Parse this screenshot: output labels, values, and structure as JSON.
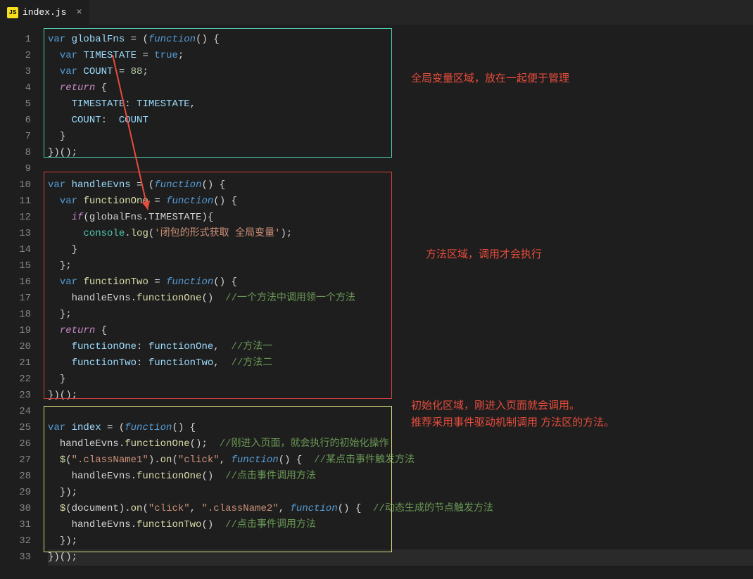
{
  "tab": {
    "filename": "index.js",
    "icon_label": "JS",
    "close": "×"
  },
  "lines": {
    "count": 33,
    "l1": {
      "a": "var",
      "b": " globalFns ",
      "c": "=",
      "d": " (",
      "e": "function",
      "f": "() {"
    },
    "l2": {
      "a": "var",
      "b": " TIMESTATE ",
      "c": "=",
      "d": " ",
      "e": "true",
      "f": ";"
    },
    "l3": {
      "a": "var",
      "b": " COUNT ",
      "c": "=",
      "d": " ",
      "e": "88",
      "f": ";"
    },
    "l4": {
      "a": "return",
      "b": " {"
    },
    "l5": {
      "a": "TIMESTATE",
      "b": ": ",
      "c": "TIMESTATE",
      "d": ","
    },
    "l6": {
      "a": "COUNT",
      "b": ":  ",
      "c": "COUNT"
    },
    "l7": {
      "a": "}"
    },
    "l8": {
      "a": "})();"
    },
    "l10": {
      "a": "var",
      "b": " handleEvns ",
      "c": "=",
      "d": " (",
      "e": "function",
      "f": "() {"
    },
    "l11": {
      "a": "var",
      "b": " ",
      "c": "functionOne",
      "d": " ",
      "e": "=",
      "f": " ",
      "g": "function",
      "h": "() {"
    },
    "l12": {
      "a": "if",
      "b": "(globalFns.TIMESTATE){"
    },
    "l13": {
      "a": "console",
      "b": ".",
      "c": "log",
      "d": "(",
      "e": "'闭包的形式获取 全局变量'",
      "f": ");"
    },
    "l14": {
      "a": "}"
    },
    "l15": {
      "a": "};"
    },
    "l16": {
      "a": "var",
      "b": " ",
      "c": "functionTwo",
      "d": " ",
      "e": "=",
      "f": " ",
      "g": "function",
      "h": "() {"
    },
    "l17": {
      "a": "handleEvns.",
      "b": "functionOne",
      "c": "()",
      "com": "//一个方法中调用领一个方法"
    },
    "l18": {
      "a": "};"
    },
    "l19": {
      "a": "return",
      "b": " {"
    },
    "l20": {
      "a": "functionOne",
      "b": ": ",
      "c": "functionOne",
      "d": ",",
      "com": "//方法一"
    },
    "l21": {
      "a": "functionTwo",
      "b": ": ",
      "c": "functionTwo",
      "d": ",",
      "com": "//方法二"
    },
    "l22": {
      "a": "}"
    },
    "l23": {
      "a": "})();"
    },
    "l25": {
      "a": "var",
      "b": " index ",
      "c": "=",
      "d": " (",
      "e": "function",
      "f": "() {"
    },
    "l26": {
      "a": "handleEvns.",
      "b": "functionOne",
      "c": "();",
      "com": "//刚进入页面，就会执行的初始化操作"
    },
    "l27": {
      "a": "$",
      "b": "(",
      "c": "\".className1\"",
      "d": ").",
      "e": "on",
      "f": "(",
      "g": "\"click\"",
      "h": ", ",
      "i": "function",
      "j": "() {",
      "com": "//某点击事件触发方法"
    },
    "l28": {
      "a": "handleEvns.",
      "b": "functionOne",
      "c": "()",
      "com": "//点击事件调用方法"
    },
    "l29": {
      "a": "});"
    },
    "l30": {
      "a": "$",
      "b": "(document).",
      "c": "on",
      "d": "(",
      "e": "\"click\"",
      "f": ", ",
      "g": "\".className2\"",
      "h": ", ",
      "i": "function",
      "j": "() {",
      "com": "//动态生成的节点触发方法"
    },
    "l31": {
      "a": "handleEvns.",
      "b": "functionTwo",
      "c": "()",
      "com": "//点击事件调用方法"
    },
    "l32": {
      "a": "});"
    },
    "l33": {
      "a": "})();"
    }
  },
  "annotations": {
    "a1": "全局变量区域，放在一起便于管理",
    "a2": "方法区域，调用才会执行",
    "a3_l1": "初始化区域，刚进入页面就会调用。",
    "a3_l2": "推荐采用事件驱动机制调用 方法区的方法。"
  },
  "colors": {
    "box_teal": "#4ec9b0",
    "box_red": "#d43f3f",
    "box_yellow": "#d7d77a",
    "annotation": "#e74c3c"
  }
}
